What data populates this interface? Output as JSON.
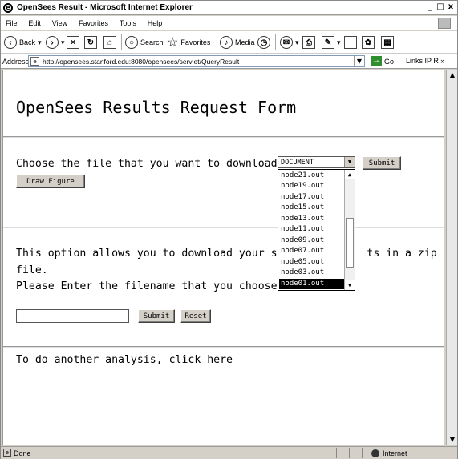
{
  "window": {
    "title": "OpenSees Result - Microsoft Internet Explorer",
    "minimize_glyph": "_",
    "maximize_glyph": "□",
    "close_glyph": "x"
  },
  "menu": [
    "File",
    "Edit",
    "View",
    "Favorites",
    "Tools",
    "Help"
  ],
  "toolbar": {
    "back_label": "Back",
    "search_label": "Search",
    "favorites_label": "Favorites",
    "media_label": "Media"
  },
  "address": {
    "label": "Address",
    "url": "http://opensees.stanford.edu:8080/opensees/servlet/QueryResult",
    "go_label": "Go",
    "links_label": "Links",
    "links_extra": "IP R »"
  },
  "page": {
    "heading": "OpenSees Results Request Form",
    "choose_text": "Choose the file that you want to download:",
    "select_value": "DOCUMENT",
    "submit_label": "Submit",
    "draw_figure_label": "Draw Figure",
    "dropdown_options": [
      "node21.out",
      "node19.out",
      "node17.out",
      "node15.out",
      "node13.out",
      "node11.out",
      "node09.out",
      "node07.out",
      "node05.out",
      "node03.out",
      "node01.out"
    ],
    "selected_option": "node01.out",
    "zip_line1_a": "This option allows you to download your sim",
    "zip_line1_b": "ts in a zip",
    "zip_line2": "file.",
    "enter_filename": "Please Enter the filename that you choose:",
    "filename_value": "",
    "submit2_label": "Submit",
    "reset_label": "Reset",
    "another_text": "To do another analysis,",
    "click_here": "click here"
  },
  "status": {
    "text": "Done",
    "zone": "Internet"
  }
}
